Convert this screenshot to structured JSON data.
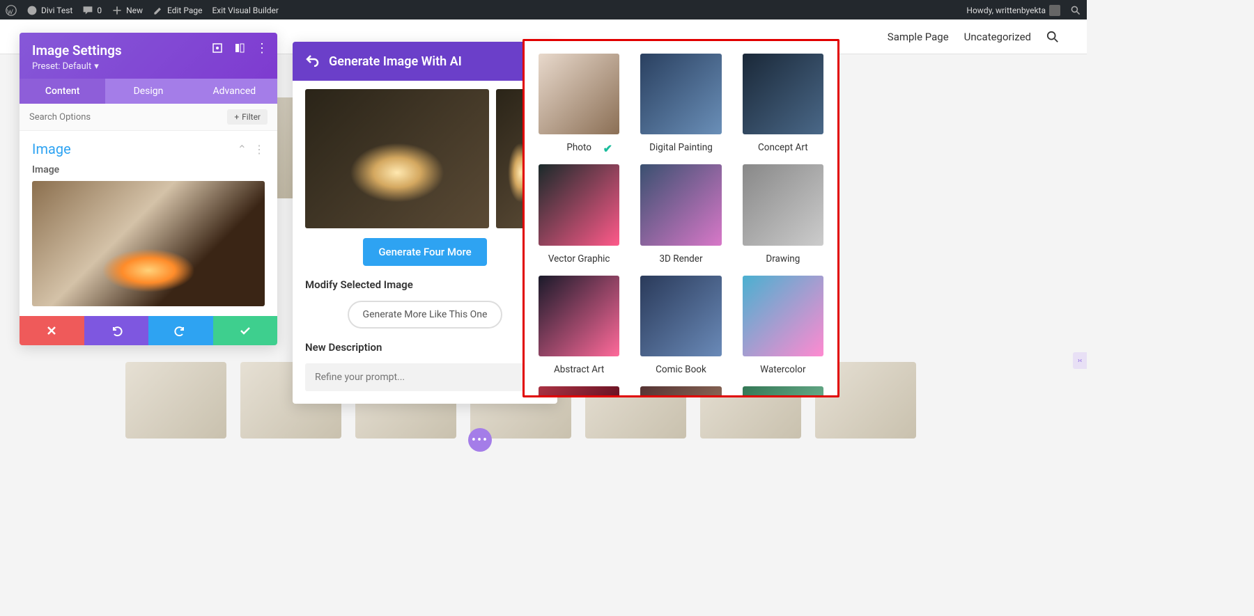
{
  "admin_bar": {
    "site_name": "Divi Test",
    "comments_count": "0",
    "new_label": "New",
    "edit_page": "Edit Page",
    "exit_builder": "Exit Visual Builder",
    "howdy": "Howdy, writtenbyekta"
  },
  "page_nav": {
    "links": [
      "Sample Page",
      "Uncategorized"
    ]
  },
  "settings_panel": {
    "title": "Image Settings",
    "preset": "Preset: Default",
    "tabs": {
      "content": "Content",
      "design": "Design",
      "advanced": "Advanced"
    },
    "search_placeholder": "Search Options",
    "filter_label": "Filter",
    "section": "Image",
    "field_label": "Image"
  },
  "ai_panel": {
    "title": "Generate Image With AI",
    "generate_button": "Generate Four More",
    "modify_title": "Modify Selected Image",
    "more_like_button": "Generate More Like This One",
    "new_description_label": "New Description",
    "refine_placeholder": "Refine your prompt..."
  },
  "style_popup": {
    "selected": "Photo",
    "styles": [
      {
        "name": "Photo",
        "cls": "st-photo"
      },
      {
        "name": "Digital Painting",
        "cls": "st-digital"
      },
      {
        "name": "Concept Art",
        "cls": "st-concept"
      },
      {
        "name": "Vector Graphic",
        "cls": "st-vector"
      },
      {
        "name": "3D Render",
        "cls": "st-3d"
      },
      {
        "name": "Drawing",
        "cls": "st-drawing"
      },
      {
        "name": "Abstract Art",
        "cls": "st-abstract"
      },
      {
        "name": "Comic Book",
        "cls": "st-comic"
      },
      {
        "name": "Watercolor",
        "cls": "st-watercolor"
      }
    ]
  }
}
